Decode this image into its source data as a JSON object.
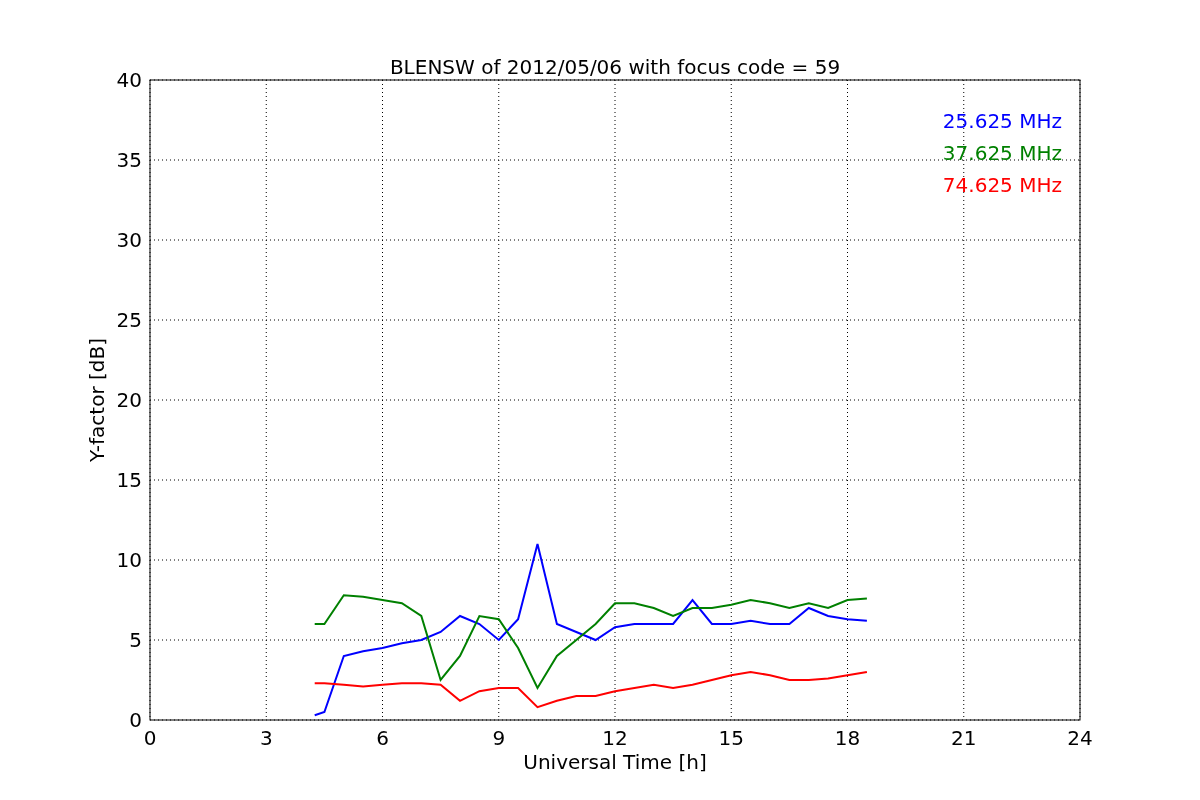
{
  "chart_data": {
    "type": "line",
    "title": "BLENSW of 2012/05/06 with focus code = 59",
    "xlabel": "Universal Time [h]",
    "ylabel": "Y-factor [dB]",
    "x": [
      4.25,
      4.5,
      5,
      5.5,
      6,
      6.5,
      7,
      7.5,
      8,
      8.5,
      9,
      9.5,
      10,
      10.5,
      11,
      11.5,
      12,
      12.5,
      13,
      13.5,
      14,
      14.5,
      15,
      15.5,
      16,
      16.5,
      17,
      17.5,
      18,
      18.5
    ],
    "series": [
      {
        "name": "25.625 MHz",
        "color": "#0000ff",
        "values": [
          0.3,
          0.5,
          4,
          4.3,
          4.5,
          4.8,
          5,
          5.5,
          6.5,
          6,
          5,
          6.3,
          11,
          6,
          5.5,
          5,
          5.8,
          6,
          6,
          6,
          7.5,
          6,
          6,
          6.2,
          6,
          6,
          7,
          6.5,
          6.3,
          6.2
        ]
      },
      {
        "name": "37.625 MHz",
        "color": "#008000",
        "values": [
          6,
          6,
          7.8,
          7.7,
          7.5,
          7.3,
          6.5,
          2.5,
          4,
          6.5,
          6.3,
          4.5,
          2,
          4,
          5,
          6,
          7.3,
          7.3,
          7,
          6.5,
          7,
          7,
          7.2,
          7.5,
          7.3,
          7,
          7.3,
          7,
          7.5,
          7.6
        ]
      },
      {
        "name": "74.625 MHz",
        "color": "#ff0000",
        "values": [
          2.3,
          2.3,
          2.2,
          2.1,
          2.2,
          2.3,
          2.3,
          2.2,
          1.2,
          1.8,
          2,
          2,
          0.8,
          1.2,
          1.5,
          1.5,
          1.8,
          2,
          2.2,
          2,
          2.2,
          2.5,
          2.8,
          3,
          2.8,
          2.5,
          2.5,
          2.6,
          2.8,
          3
        ]
      }
    ],
    "grid": true,
    "xlim": [
      0,
      24
    ],
    "ylim": [
      0,
      40
    ],
    "xticks": [
      0,
      3,
      6,
      9,
      12,
      15,
      18,
      21,
      24
    ],
    "yticks": [
      0,
      5,
      10,
      15,
      20,
      25,
      30,
      35,
      40
    ]
  }
}
